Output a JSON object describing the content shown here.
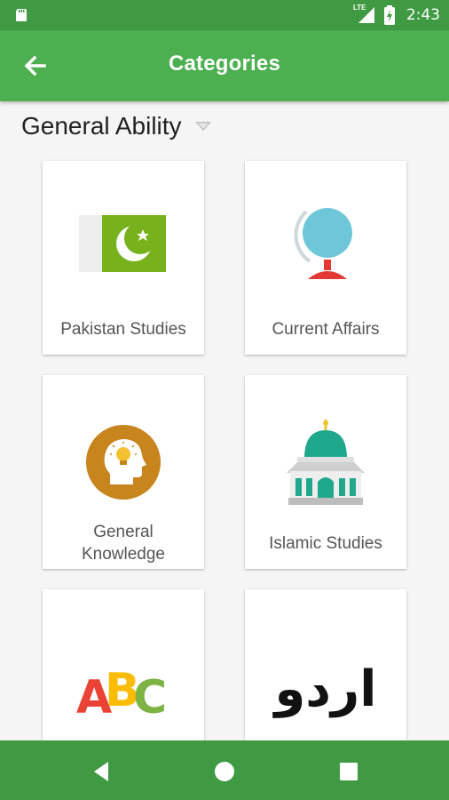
{
  "status_bar": {
    "network": "LTE",
    "time": "2:43"
  },
  "app_bar": {
    "title": "Categories"
  },
  "selector": {
    "value": "General Ability"
  },
  "categories": [
    {
      "label": "Pakistan Studies",
      "icon": "pakistan-flag-icon"
    },
    {
      "label": "Current Affairs",
      "icon": "globe-icon"
    },
    {
      "label": "General\nKnowledge",
      "icon": "head-lightbulb-icon"
    },
    {
      "label": "Islamic Studies",
      "icon": "mosque-icon"
    },
    {
      "label": "",
      "icon": "abc-letters-icon"
    },
    {
      "label": "",
      "icon": "urdu-script-icon"
    }
  ],
  "urdu_text": "اردو",
  "abc_text": [
    "A",
    "B",
    "C"
  ],
  "colors": {
    "status_bar": "#3f9a43",
    "app_bar": "#4caf50",
    "nav_bar": "#3f9a43"
  }
}
